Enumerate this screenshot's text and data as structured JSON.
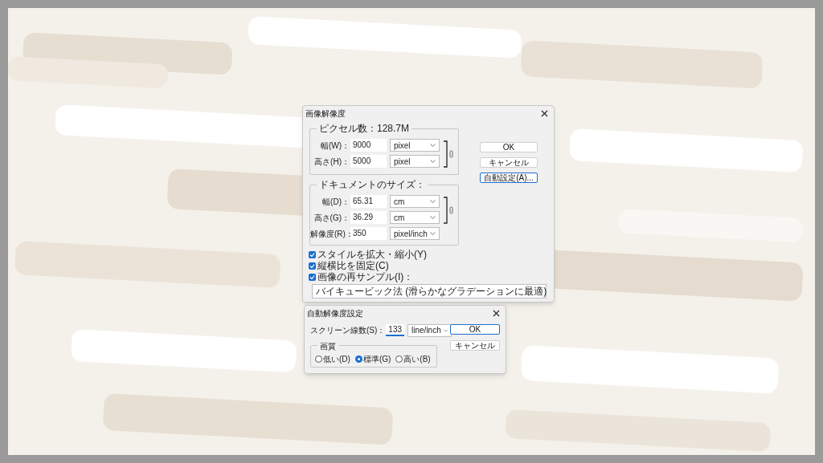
{
  "image_size_dialog": {
    "title": "画像解像度",
    "pixel_group": {
      "legend": "ピクセル数：128.7M",
      "fields": [
        {
          "label": "幅(W)：",
          "value": "9000",
          "unit": "pixel"
        },
        {
          "label": "高さ(H)：",
          "value": "5000",
          "unit": "pixel"
        }
      ]
    },
    "document_group": {
      "legend": "ドキュメントのサイズ：",
      "fields": [
        {
          "label": "幅(D)：",
          "value": "65.31",
          "unit": "cm"
        },
        {
          "label": "高さ(G)：",
          "value": "36.29",
          "unit": "cm"
        },
        {
          "label": "解像度(R)：",
          "value": "350",
          "unit": "pixel/inch"
        }
      ]
    },
    "checkboxes": [
      {
        "label": "スタイルを拡大・縮小(Y)",
        "checked": true
      },
      {
        "label": "縦横比を固定(C)",
        "checked": true
      },
      {
        "label": "画像の再サンプル(I)：",
        "checked": true
      }
    ],
    "resample_method": "バイキュービック法 (滑らかなグラデーションに最適)",
    "buttons": [
      {
        "label": "OK",
        "focused": false
      },
      {
        "label": "キャンセル",
        "focused": false
      },
      {
        "label": "自動設定(A)...",
        "focused": true
      }
    ]
  },
  "auto_resolution_dialog": {
    "title": "自動解像度設定",
    "screen_field": {
      "label": "スクリーン線数(S)：",
      "value": "133",
      "unit": "line/inch"
    },
    "quality_group": {
      "legend": "画質",
      "options": [
        {
          "label": "低い(D)",
          "selected": false
        },
        {
          "label": "標準(G)",
          "selected": true
        },
        {
          "label": "高い(B)",
          "selected": false
        }
      ]
    },
    "buttons": [
      {
        "label": "OK",
        "focused": true
      },
      {
        "label": "キャンセル",
        "focused": false
      }
    ]
  }
}
